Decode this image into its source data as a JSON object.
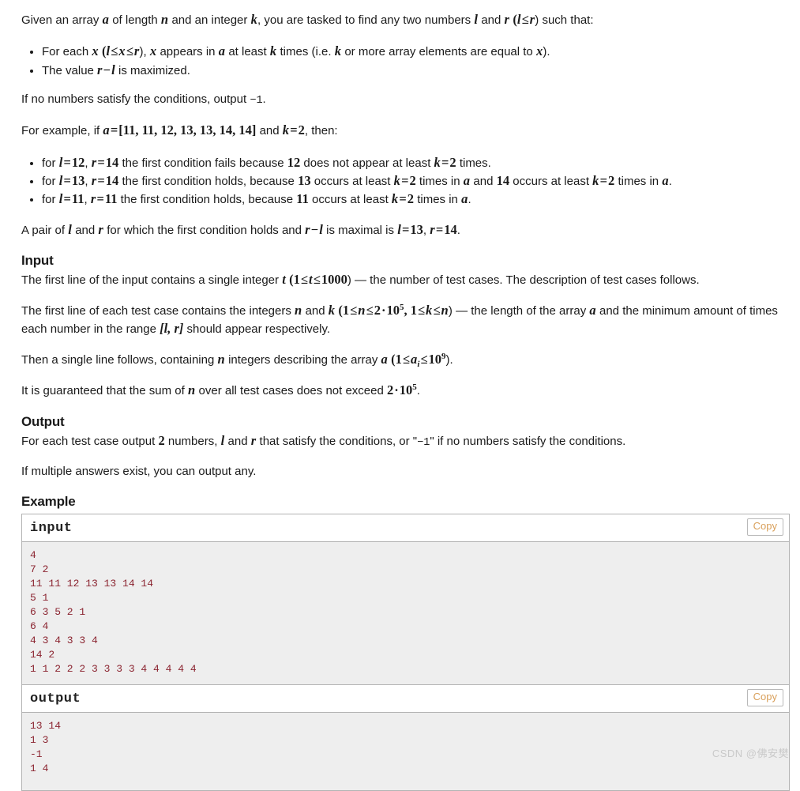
{
  "intro": {
    "line_1": "Given an array",
    "a": "a",
    "line_2": "of length",
    "n": "n",
    "line_3": "and an integer",
    "k": "k",
    "line_4": ", you are tasked to find any two numbers",
    "l": "l",
    "and": "and",
    "r": "r",
    "paren": "(",
    "le": "≤",
    "close": ") such that:"
  },
  "conditions": [
    {
      "prefix": "For each",
      "x": "x",
      "open": "(",
      "l": "l",
      "le1": "≤",
      "x2": "x",
      "le2": "≤",
      "r": "r",
      "close": ")",
      "mid": ",",
      "x3": "x",
      "text1": "appears in",
      "a": "a",
      "text2": "at least",
      "k": "k",
      "text3": "times (i.e.",
      "k2": "k",
      "text4": "or more array elements are equal to",
      "x4": "x",
      "text5": ")."
    },
    {
      "prefix": "The value",
      "r": "r",
      "minus": "−",
      "l": "l",
      "text1": "is maximized."
    }
  ],
  "no_numbers": {
    "text_1": "If no numbers satisfy the conditions, output",
    "value": "−1",
    "text_2": "."
  },
  "example_intro": {
    "text_1": "For example, if",
    "a": "a",
    "eq": "=",
    "array": "[11, 11, 12, 13, 13, 14, 14]",
    "text_2": "and",
    "k": "k",
    "eq2": "=",
    "two": "2",
    "text_3": ", then:"
  },
  "example_bullets": [
    {
      "for": "for",
      "l": "l",
      "eq1": "=",
      "lval": "12",
      "comma": ",",
      "r": "r",
      "eq2": "=",
      "rval": "14",
      "text1": "the first condition fails because",
      "num": "12",
      "text2": "does not appear at least",
      "k": "k",
      "eq3": "=",
      "kval": "2",
      "text3": "times."
    },
    {
      "for": "for",
      "l": "l",
      "eq1": "=",
      "lval": "13",
      "comma": ",",
      "r": "r",
      "eq2": "=",
      "rval": "14",
      "text1": "the first condition holds, because",
      "num": "13",
      "text2": "occurs at least",
      "k": "k",
      "eq3": "=",
      "kval": "2",
      "text3": "times in",
      "a": "a",
      "text4": "and",
      "num2": "14",
      "text5": "occurs at least",
      "k2": "k",
      "eq4": "=",
      "kval2": "2",
      "text6": "times in",
      "a2": "a",
      "text7": "."
    },
    {
      "for": "for",
      "l": "l",
      "eq1": "=",
      "lval": "11",
      "comma": ",",
      "r": "r",
      "eq2": "=",
      "rval": "11",
      "text1": "the first condition holds, because",
      "num": "11",
      "text2": "occurs at least",
      "k": "k",
      "eq3": "=",
      "kval": "2",
      "text3": "times in",
      "a": "a",
      "text4": "."
    }
  ],
  "pair_sentence": {
    "text_1": "A pair of",
    "l": "l",
    "and": "and",
    "r": "r",
    "text_2": "for which the first condition holds and",
    "r2": "r",
    "minus": "−",
    "l2": "l",
    "text_3": "is maximal is",
    "l3": "l",
    "eq1": "=",
    "lval": "13",
    "comma": ",",
    "r3": "r",
    "eq2": "=",
    "rval": "14",
    "period": "."
  },
  "input_section": {
    "heading": "Input",
    "p1": {
      "text_1": "The first line of the input contains a single integer",
      "t": "t",
      "open": "(1",
      "le1": "≤",
      "t2": "t",
      "le2": "≤",
      "max": "1000",
      "close": ")",
      "text_2": "— the number of test cases. The description of test cases follows."
    },
    "p2": {
      "text_1": "The first line of each test case contains the integers",
      "n": "n",
      "and": "and",
      "k": "k",
      "open": "(1",
      "le1": "≤",
      "n2": "n",
      "le2": "≤",
      "two": "2",
      "dot": "·",
      "ten": "10",
      "exp": "5",
      "comma": ", 1",
      "le3": "≤",
      "k2": "k",
      "le4": "≤",
      "n3": "n",
      "close": ")",
      "text_2": "— the length of the array",
      "a": "a",
      "text_3": "and the minimum amount of times each number in the range",
      "range": "[l, r]",
      "text_4": "should appear respectively."
    },
    "p3": {
      "text_1": "Then a single line follows, containing",
      "n": "n",
      "text_2": "integers describing the array",
      "a": "a",
      "open": "(1",
      "le1": "≤",
      "ai": "a",
      "sub": "i",
      "le2": "≤",
      "ten": "10",
      "exp": "9",
      "close": ")."
    },
    "p4": {
      "text_1": "It is guaranteed that the sum of",
      "n": "n",
      "text_2": "over all test cases does not exceed",
      "two": "2",
      "dot": "·",
      "ten": "10",
      "exp": "5",
      "period": "."
    }
  },
  "output_section": {
    "heading": "Output",
    "p1": {
      "text_1": "For each test case output",
      "two": "2",
      "text_2": "numbers,",
      "l": "l",
      "and": "and",
      "r": "r",
      "text_3": "that satisfy the conditions, or \"",
      "minus_one": "−1",
      "text_4": "\" if no numbers satisfy the conditions."
    },
    "p2": "If multiple answers exist, you can output any."
  },
  "example_section": {
    "heading": "Example",
    "blocks": [
      {
        "title": "input",
        "copy_label": "Copy",
        "content": "4\n7 2\n11 11 12 13 13 14 14\n5 1\n6 3 5 2 1\n6 4\n4 3 4 3 3 4\n14 2\n1 1 2 2 2 3 3 3 3 4 4 4 4 4"
      },
      {
        "title": "output",
        "copy_label": "Copy",
        "content": "13 14\n1 3\n-1\n1 4"
      }
    ]
  },
  "watermark": "CSDN @佛安樊",
  "colors": {
    "code_text": "#8b2430",
    "code_bg": "#eeeeee",
    "copy_text": "#d9a05b",
    "border": "#b3b3b3"
  }
}
